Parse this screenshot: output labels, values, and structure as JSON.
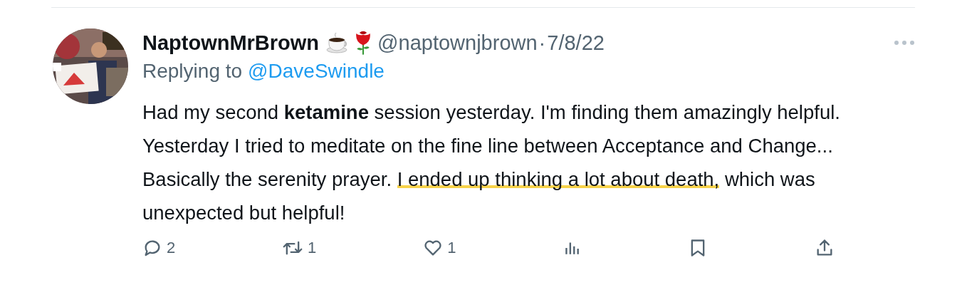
{
  "tweet": {
    "author": {
      "name": "NaptownMrBrown",
      "handle": "@naptownjbrown",
      "separator": "·",
      "date": "7/8/22"
    },
    "reply_to": {
      "label": "Replying to",
      "handle": "@DaveSwindle"
    },
    "body": [
      {
        "kind": "plain",
        "text": "Had my second "
      },
      {
        "kind": "bold",
        "text": "ketamine"
      },
      {
        "kind": "plain",
        "text": " session yesterday. I'm finding them amazingly helpful. Yesterday I tried to meditate on the fine line between Acceptance and Change... Basically the serenity prayer. "
      },
      {
        "kind": "highlight",
        "text": "I ended up thinking a lot about death,"
      },
      {
        "kind": "plain",
        "text": " which was unexpected but helpful!"
      }
    ],
    "actions": [
      {
        "kind": "reply",
        "count": "2"
      },
      {
        "kind": "repost",
        "count": "1"
      },
      {
        "kind": "like",
        "count": "1"
      },
      {
        "kind": "views"
      },
      {
        "kind": "bookmark"
      },
      {
        "kind": "share"
      }
    ]
  }
}
